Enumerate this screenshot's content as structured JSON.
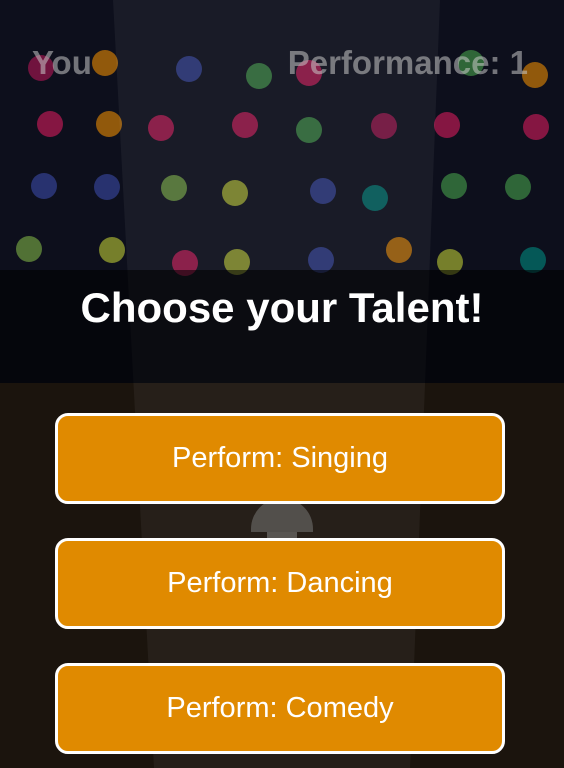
{
  "hud": {
    "player_label": "You",
    "performance_label": "Performance: 1"
  },
  "heading": "Choose your Talent!",
  "talents": [
    {
      "label": "Perform: Singing"
    },
    {
      "label": "Perform: Dancing"
    },
    {
      "label": "Perform: Comedy"
    }
  ],
  "colors": {
    "button": "#e08a00",
    "button_border": "#ffffff",
    "heading_text": "#ffffff",
    "hud_text": "#c8c8c8",
    "backdrop": "#0d0f1c",
    "floor": "#1b140d"
  },
  "crowd_palette": [
    "#c2185b",
    "#e91e63",
    "#ff9800",
    "#3f51b5",
    "#4caf50",
    "#9c27b0",
    "#009688",
    "#8bc34a"
  ]
}
